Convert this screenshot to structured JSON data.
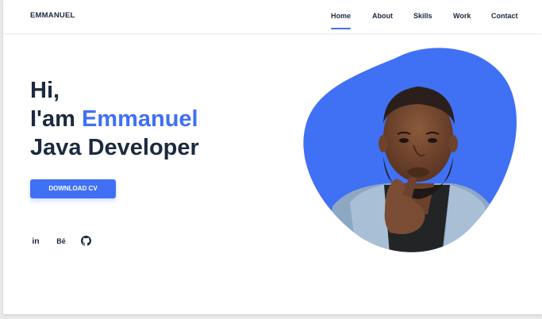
{
  "header": {
    "logo": "EMMANUEL",
    "nav": [
      {
        "label": "Home",
        "active": true
      },
      {
        "label": "About",
        "active": false
      },
      {
        "label": "Skills",
        "active": false
      },
      {
        "label": "Work",
        "active": false
      },
      {
        "label": "Contact",
        "active": false
      }
    ]
  },
  "hero": {
    "greeting": "Hi,",
    "intro": "I'am",
    "name": "Emmanuel",
    "role": "Java Developer",
    "button_label": "DOWNLOAD CV"
  },
  "social": [
    {
      "icon": "linkedin-icon",
      "label": "in"
    },
    {
      "icon": "behance-icon",
      "label": "Bē"
    },
    {
      "icon": "github-icon",
      "label": ""
    }
  ],
  "colors": {
    "accent": "#4070f4",
    "text": "#1c2a3f",
    "background": "#ffffff"
  }
}
